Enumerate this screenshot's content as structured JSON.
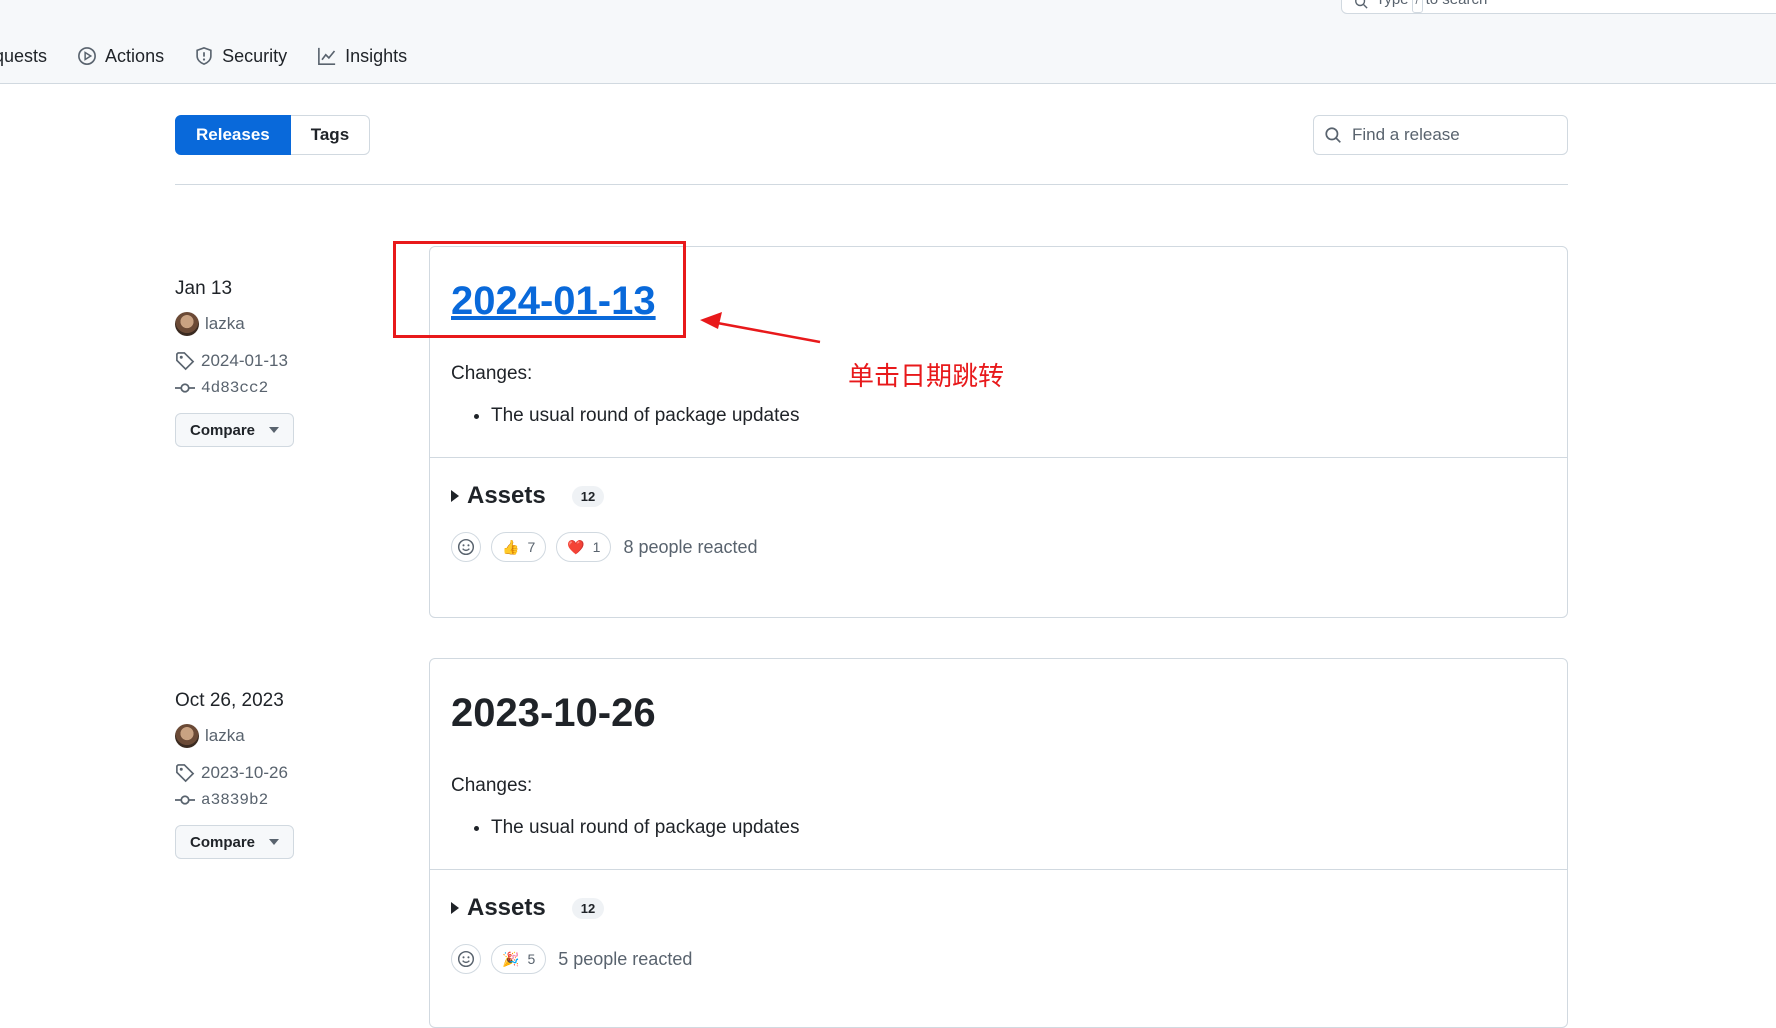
{
  "top_search": {
    "prefix": "Type",
    "key": "/",
    "suffix": "to search"
  },
  "nav": {
    "items": [
      {
        "label": "quests"
      },
      {
        "label": "Actions"
      },
      {
        "label": "Security"
      },
      {
        "label": "Insights"
      }
    ]
  },
  "subnav": {
    "releases_label": "Releases",
    "tags_label": "Tags",
    "find_placeholder": "Find a release"
  },
  "releases": [
    {
      "date": "Jan 13",
      "author": "lazka",
      "tag": "2024-01-13",
      "commit": "4d83cc2",
      "compare_label": "Compare",
      "title": "2024-01-13",
      "changes_label": "Changes:",
      "bullet": "The usual round of package updates",
      "assets_label": "Assets",
      "assets_count": "12",
      "reactions": [
        {
          "emoji": "👍",
          "count": "7"
        },
        {
          "emoji": "❤️",
          "count": "1"
        }
      ],
      "reacted_text": "8 people reacted"
    },
    {
      "date": "Oct 26, 2023",
      "author": "lazka",
      "tag": "2023-10-26",
      "commit": "a3839b2",
      "compare_label": "Compare",
      "title": "2023-10-26",
      "changes_label": "Changes:",
      "bullet": "The usual round of package updates",
      "assets_label": "Assets",
      "assets_count": "12",
      "reactions": [
        {
          "emoji": "🎉",
          "count": "5"
        }
      ],
      "reacted_text": "5 people reacted"
    }
  ],
  "annotation": {
    "text": "单击日期跳转",
    "color": "#e8191b"
  },
  "colors": {
    "accent": "#0969da",
    "border": "#d1d9e0",
    "muted": "#59636e"
  }
}
